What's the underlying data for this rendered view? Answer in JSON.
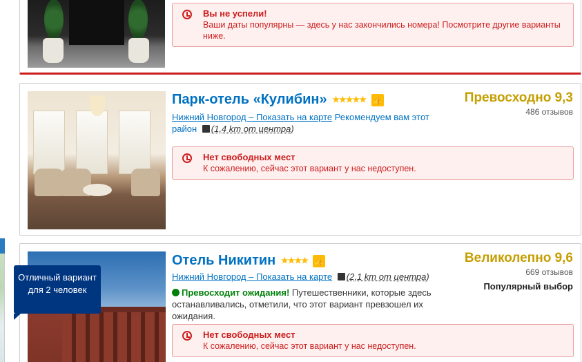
{
  "hotels": [
    {
      "alert": {
        "heading": "Вы не успели!",
        "body": "Ваши даты популярны — здесь у нас закончились номера! Посмотрите другие варианты ниже."
      }
    },
    {
      "name": "Парк-отель «Кулибин»",
      "stars": "★★★★★",
      "thumb_icon": "thumbs-up-icon",
      "location_link": "Нижний Новгород – Показать на карте",
      "recommend": "Рекомендуем вам этот район",
      "distance": "(1,4 km от центра)",
      "score_word": "Превосходно 9,3",
      "reviews": "486 отзывов",
      "alert": {
        "heading": "Нет свободных мест",
        "body": "К сожалению, сейчас этот вариант у нас недоступен."
      }
    },
    {
      "name": "Отель Никитин",
      "stars": "★★★★",
      "thumb_icon": "thumbs-up-icon",
      "location_link": "Нижний Новгород – Показать на карте",
      "distance": "(2,1 km от центра)",
      "score_word": "Великолепно 9,6",
      "reviews": "669 отзывов",
      "popular": "Популярный выбор",
      "badge": "Отличный вариант для 2 человек",
      "exceeded_label": "Превосходит ожидания!",
      "exceeded_text": "Путешественники, которые здесь останавливались, отметили, что этот вариант превзошел их ожидания.",
      "alert": {
        "heading": "Нет свободных мест",
        "body": "К сожалению, сейчас этот вариант у нас недоступен."
      }
    }
  ],
  "colors": {
    "link": "#0071c2",
    "star": "#febb02",
    "score": "#c59e00",
    "alert": "#cc1d1d",
    "badge": "#003580"
  }
}
